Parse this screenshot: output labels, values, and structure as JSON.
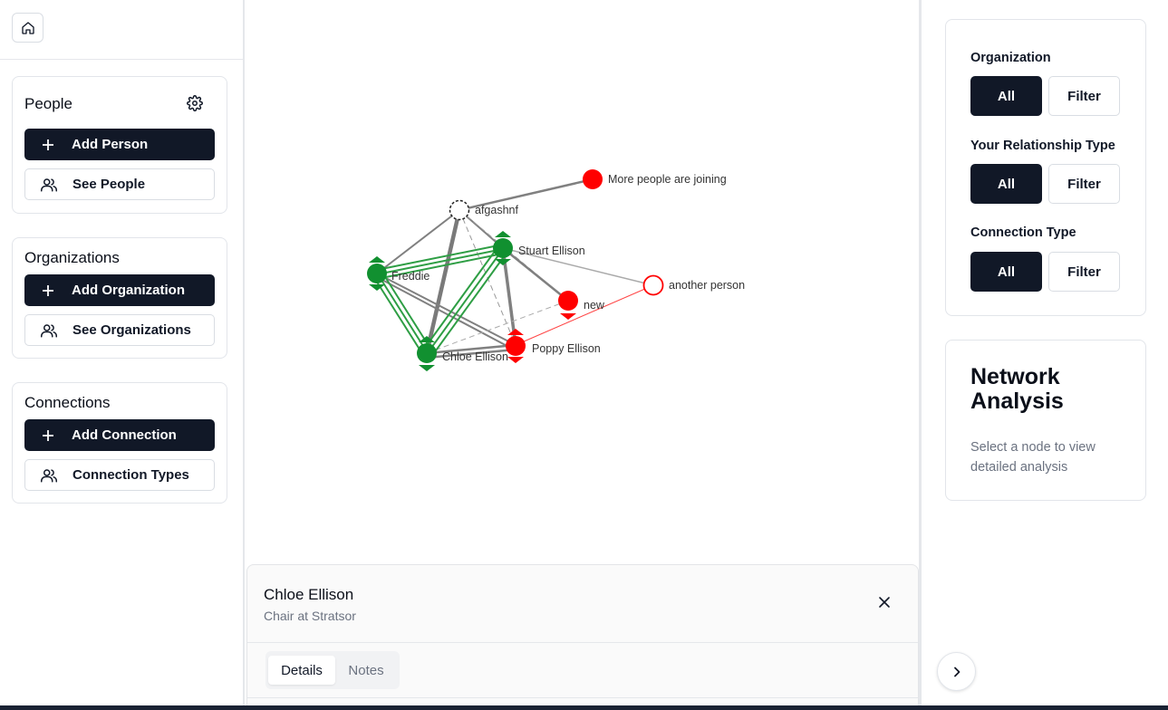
{
  "sidebar": {
    "people": {
      "title": "People",
      "add": "Add Person",
      "see": "See People"
    },
    "organizations": {
      "title": "Organizations",
      "add": "Add Organization",
      "see": "See Organizations"
    },
    "connections": {
      "title": "Connections",
      "add": "Add Connection",
      "types": "Connection Types"
    }
  },
  "graph": {
    "nodes": {
      "more": "More people are joining",
      "afgashnf": "afgashnf",
      "stuart": "Stuart Ellison",
      "freddie": "Freddie",
      "another": "another person",
      "new": "new",
      "poppy": "Poppy Ellison",
      "chloe": "Chloe Ellison"
    },
    "colors": {
      "green": "#119030",
      "red": "#ff0000",
      "edge": "#808080",
      "edge_light": "#aaaaaa"
    }
  },
  "details": {
    "name": "Chloe Ellison",
    "subtitle": "Chair at Stratsor",
    "tabs": {
      "details": "Details",
      "notes": "Notes"
    }
  },
  "filters": {
    "organization": {
      "label": "Organization",
      "all": "All",
      "filter": "Filter"
    },
    "relationship": {
      "label": "Your Relationship Type",
      "all": "All",
      "filter": "Filter"
    },
    "connection": {
      "label": "Connection Type",
      "all": "All",
      "filter": "Filter"
    }
  },
  "analysis": {
    "title": "Network Analysis",
    "text": "Select a node to view detailed analysis"
  },
  "icons": {
    "home": "home-icon",
    "gear": "gear-icon",
    "plus": "plus-icon",
    "users": "users-icon",
    "close": "close-icon",
    "chevron": "chevron-right-icon"
  }
}
